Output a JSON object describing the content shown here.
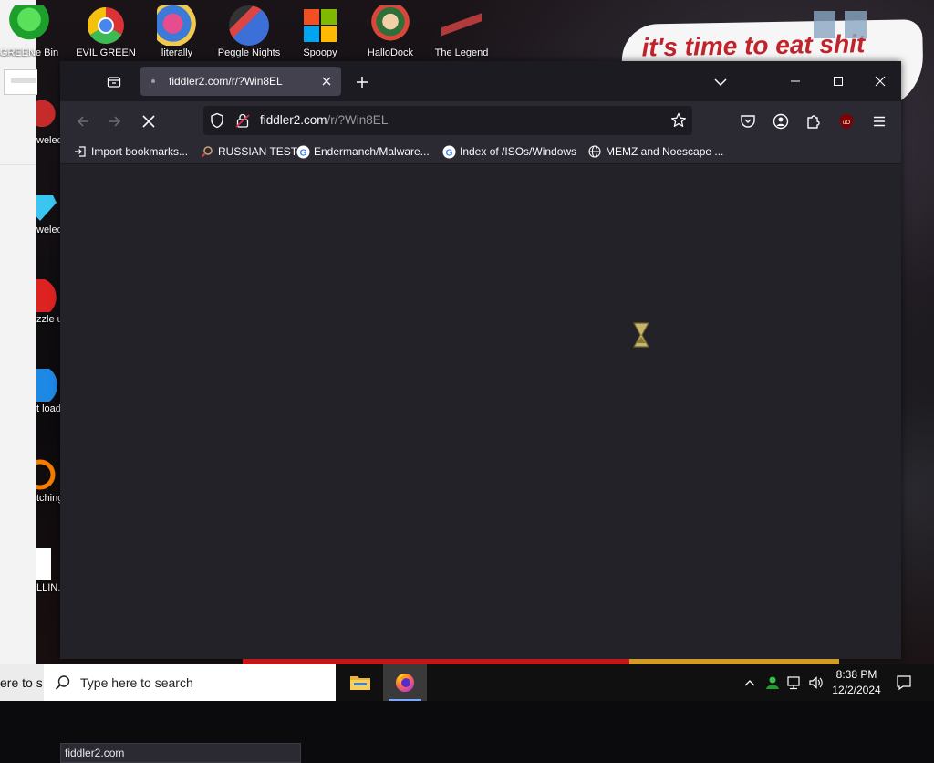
{
  "desktop": {
    "top_icons": [
      {
        "label": "GREENe Bin"
      },
      {
        "label": "EVIL GREEN"
      },
      {
        "label": "literally"
      },
      {
        "label": "Peggle Nights"
      },
      {
        "label": "Spoopy"
      },
      {
        "label": "HalloDock"
      },
      {
        "label": "The Legend"
      }
    ],
    "left_icons": [
      {
        "label": "weled Z uxe"
      },
      {
        "label": "weled uxe"
      },
      {
        "label": "zzle uxe"
      },
      {
        "label": "t load"
      },
      {
        "label": "tching"
      },
      {
        "label": "LLIN."
      }
    ],
    "caption_text": "it's time to eat shit"
  },
  "browser": {
    "tab": {
      "title": "fiddler2.com/r/?Win8EL"
    },
    "url": {
      "host": "fiddler2.com",
      "path": "/r/?Win8EL"
    },
    "bookmarks": [
      {
        "label": "Import bookmarks...",
        "icon": "import-icon"
      },
      {
        "label": "RUSSIAN TEST",
        "icon": "magnifier-favicon"
      },
      {
        "label": "Endermanch/Malware...",
        "icon": "google-favicon"
      },
      {
        "label": "Index of /ISOs/Windows",
        "icon": "google-favicon"
      },
      {
        "label": "MEMZ and Noescape ...",
        "icon": "globe-icon"
      }
    ],
    "status_text": "fiddler2.com",
    "colors": {
      "frame": "#1c1b22",
      "toolbar": "#2b2a33",
      "content": "#232229"
    }
  },
  "taskbar": {
    "left_text": "ere to s",
    "search_placeholder": "Type here to search",
    "time": "8:38 PM",
    "date": "12/2/2024"
  }
}
